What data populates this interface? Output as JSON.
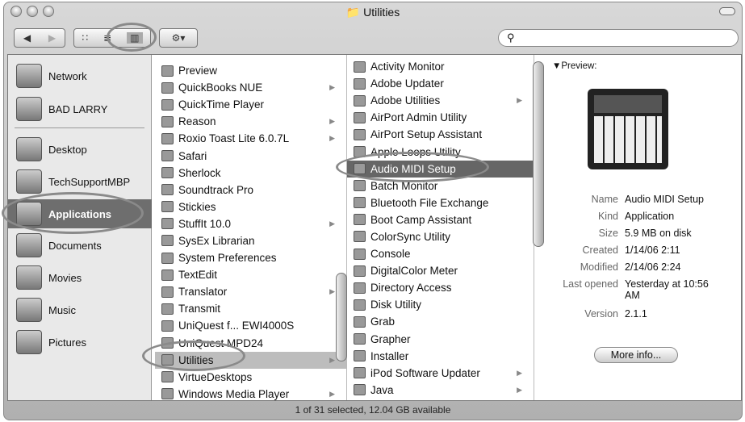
{
  "window": {
    "title": "Utilities",
    "status": "1 of 31 selected, 12.04 GB available"
  },
  "toolbar": {
    "back": "◀",
    "forward": "▶",
    "icon_view": "∷",
    "list_view": "≣",
    "column_view": "▥",
    "action": "⚙▾",
    "search_icon": "⚲",
    "search_value": ""
  },
  "sidebar": {
    "items": [
      {
        "label": "Network"
      },
      {
        "label": "BAD LARRY"
      },
      {
        "label": "Desktop"
      },
      {
        "label": "TechSupportMBP"
      },
      {
        "label": "Applications",
        "selected": true
      },
      {
        "label": "Documents"
      },
      {
        "label": "Movies"
      },
      {
        "label": "Music"
      },
      {
        "label": "Pictures"
      }
    ]
  },
  "column1": {
    "items": [
      {
        "label": "Preview"
      },
      {
        "label": "QuickBooks NUE",
        "folder": true
      },
      {
        "label": "QuickTime Player"
      },
      {
        "label": "Reason",
        "folder": true
      },
      {
        "label": "Roxio Toast Lite 6.0.7L",
        "folder": true
      },
      {
        "label": "Safari"
      },
      {
        "label": "Sherlock"
      },
      {
        "label": "Soundtrack Pro"
      },
      {
        "label": "Stickies"
      },
      {
        "label": "StuffIt 10.0",
        "folder": true
      },
      {
        "label": "SysEx Librarian"
      },
      {
        "label": "System Preferences"
      },
      {
        "label": "TextEdit"
      },
      {
        "label": "Translator",
        "folder": true
      },
      {
        "label": "Transmit"
      },
      {
        "label": "UniQuest f... EWI4000S"
      },
      {
        "label": "UniQuest MPD24"
      },
      {
        "label": "Utilities",
        "folder": true,
        "selected": true
      },
      {
        "label": "VirtueDesktops"
      },
      {
        "label": "Windows Media Player",
        "folder": true
      }
    ]
  },
  "column2": {
    "items": [
      {
        "label": "Activity Monitor"
      },
      {
        "label": "Adobe Updater"
      },
      {
        "label": "Adobe Utilities",
        "folder": true
      },
      {
        "label": "AirPort Admin Utility"
      },
      {
        "label": "AirPort Setup Assistant"
      },
      {
        "label": "Apple Loops Utility"
      },
      {
        "label": "Audio MIDI Setup",
        "selected": true
      },
      {
        "label": "Batch Monitor"
      },
      {
        "label": "Bluetooth File Exchange"
      },
      {
        "label": "Boot Camp Assistant"
      },
      {
        "label": "ColorSync Utility"
      },
      {
        "label": "Console"
      },
      {
        "label": "DigitalColor Meter"
      },
      {
        "label": "Directory Access"
      },
      {
        "label": "Disk Utility"
      },
      {
        "label": "Grab"
      },
      {
        "label": "Grapher"
      },
      {
        "label": "Installer"
      },
      {
        "label": "iPod Software Updater",
        "folder": true
      },
      {
        "label": "Java",
        "folder": true
      }
    ]
  },
  "preview": {
    "header": "▼Preview:",
    "fields": [
      {
        "key": "Name",
        "value": "Audio MIDI Setup"
      },
      {
        "key": "Kind",
        "value": "Application"
      },
      {
        "key": "Size",
        "value": "5.9 MB on disk"
      },
      {
        "key": "Created",
        "value": "1/14/06 2:11"
      },
      {
        "key": "Modified",
        "value": "2/14/06 2:24"
      },
      {
        "key": "Last opened",
        "value": "Yesterday at 10:56 AM"
      },
      {
        "key": "Version",
        "value": "2.1.1"
      }
    ],
    "more_info": "More info..."
  }
}
